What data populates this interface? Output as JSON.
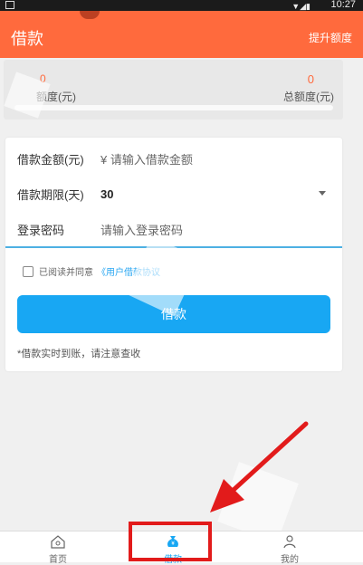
{
  "status_bar": {
    "time": "10:27"
  },
  "header": {
    "title": "借款",
    "action": "提升额度"
  },
  "summary": {
    "available_value": "0",
    "available_label": "额度(元)",
    "total_value": "0",
    "total_label": "总额度(元)",
    "progress_percent": 0
  },
  "form": {
    "amount": {
      "label": "借款金额(元)",
      "currency": "¥",
      "placeholder": "请输入借款金额"
    },
    "term": {
      "label": "借款期限(天)",
      "value": "30"
    },
    "password": {
      "label": "登录密码",
      "placeholder": "请输入登录密码"
    },
    "agreement": {
      "prefix": "已阅读并同意",
      "link": "《用户借款协议"
    },
    "submit_label": "借款",
    "note": "*借款实时到账，请注意查收"
  },
  "tabbar": {
    "items": [
      {
        "label": "首页",
        "icon": "home-icon"
      },
      {
        "label": "借款",
        "icon": "money-bag-icon",
        "active": true
      },
      {
        "label": "我的",
        "icon": "user-icon"
      }
    ]
  },
  "colors": {
    "primary_orange": "#ff6a3d",
    "primary_blue": "#18a7f3",
    "annotation_red": "#e21b1b"
  }
}
